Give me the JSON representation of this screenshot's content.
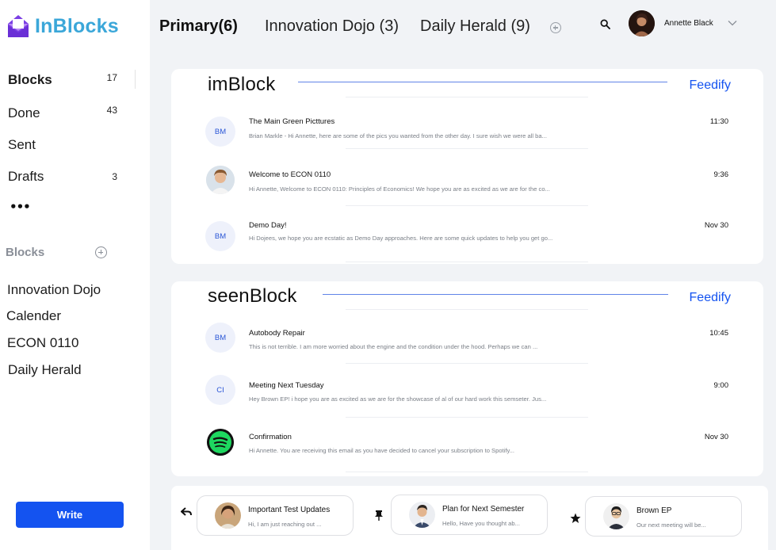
{
  "app": {
    "name": "InBlocks",
    "brand_color": "#3ba7d9",
    "accent": "#1453f0"
  },
  "sidebar": {
    "nav": [
      {
        "label": "Blocks",
        "count": "17",
        "active": true
      },
      {
        "label": "Done",
        "count": "43"
      },
      {
        "label": "Sent",
        "count": ""
      },
      {
        "label": "Drafts",
        "count": "3"
      }
    ],
    "more_label": "•••",
    "blocks_header": "Blocks",
    "blocks": [
      "Innovation Dojo",
      "Calender",
      "ECON 0110",
      "Daily Herald"
    ],
    "write_label": "Write"
  },
  "header": {
    "tabs": [
      {
        "label": "Primary(6)"
      },
      {
        "label": "Innovation Dojo (3)"
      },
      {
        "label": "Daily Herald (9)"
      }
    ],
    "user_name": "Annette Black"
  },
  "cards": [
    {
      "title": "imBlock",
      "action": "Feedify",
      "rows": [
        {
          "avatar_text": "BM",
          "avatar_type": "initials",
          "subject": "The Main Green Picttures",
          "preview": "Brian Markle - Hi Annette, here are some of the pics you wanted from the other day. I sure wish we were all ba...",
          "time": "11:30"
        },
        {
          "avatar_text": "",
          "avatar_type": "photo-man",
          "subject": "Welcome to ECON 0110",
          "preview": "Hi Annette, Welcome to ECON 0110: Principles of Economics! We hope you are  as excited as we are for the co...",
          "time": "9:36"
        },
        {
          "avatar_text": "BM",
          "avatar_type": "initials",
          "subject": "Demo Day!",
          "preview": "Hi Dojees, we hope you are ecstatic as Demo Day approaches. Here are some quick updates to help you get go...",
          "time": "Nov 30"
        }
      ]
    },
    {
      "title": "seenBlock",
      "action": "Feedify",
      "rows": [
        {
          "avatar_text": "BM",
          "avatar_type": "initials",
          "subject": "Autobody Repair",
          "preview": "This is not terrible. I am more worried about the engine and the condition under the hood. Perhaps we can ...",
          "time": "10:45"
        },
        {
          "avatar_text": "CI",
          "avatar_type": "initials",
          "subject": "Meeting Next Tuesday",
          "preview": "Hey Brown EP! i hope you are as  excited as we are for the showcase of al of our hard work this semseter. Jus...",
          "time": "9:00"
        },
        {
          "avatar_text": "",
          "avatar_type": "spotify",
          "subject": "Confirmation",
          "preview": "Hi Annette. You are receiving this email as you have decided to cancel your subscription to Spotify...",
          "time": "Nov 30"
        }
      ]
    }
  ],
  "pinned": [
    {
      "icon": "reply-icon",
      "title": "Important Test Updates",
      "preview": "Hi, I am just reaching out ..."
    },
    {
      "icon": "pin-icon",
      "title": "Plan for Next Semester",
      "preview": "Hello, Have you thought ab..."
    },
    {
      "icon": "star-icon",
      "title": "Brown EP",
      "preview": "Our next meeting will be..."
    }
  ]
}
